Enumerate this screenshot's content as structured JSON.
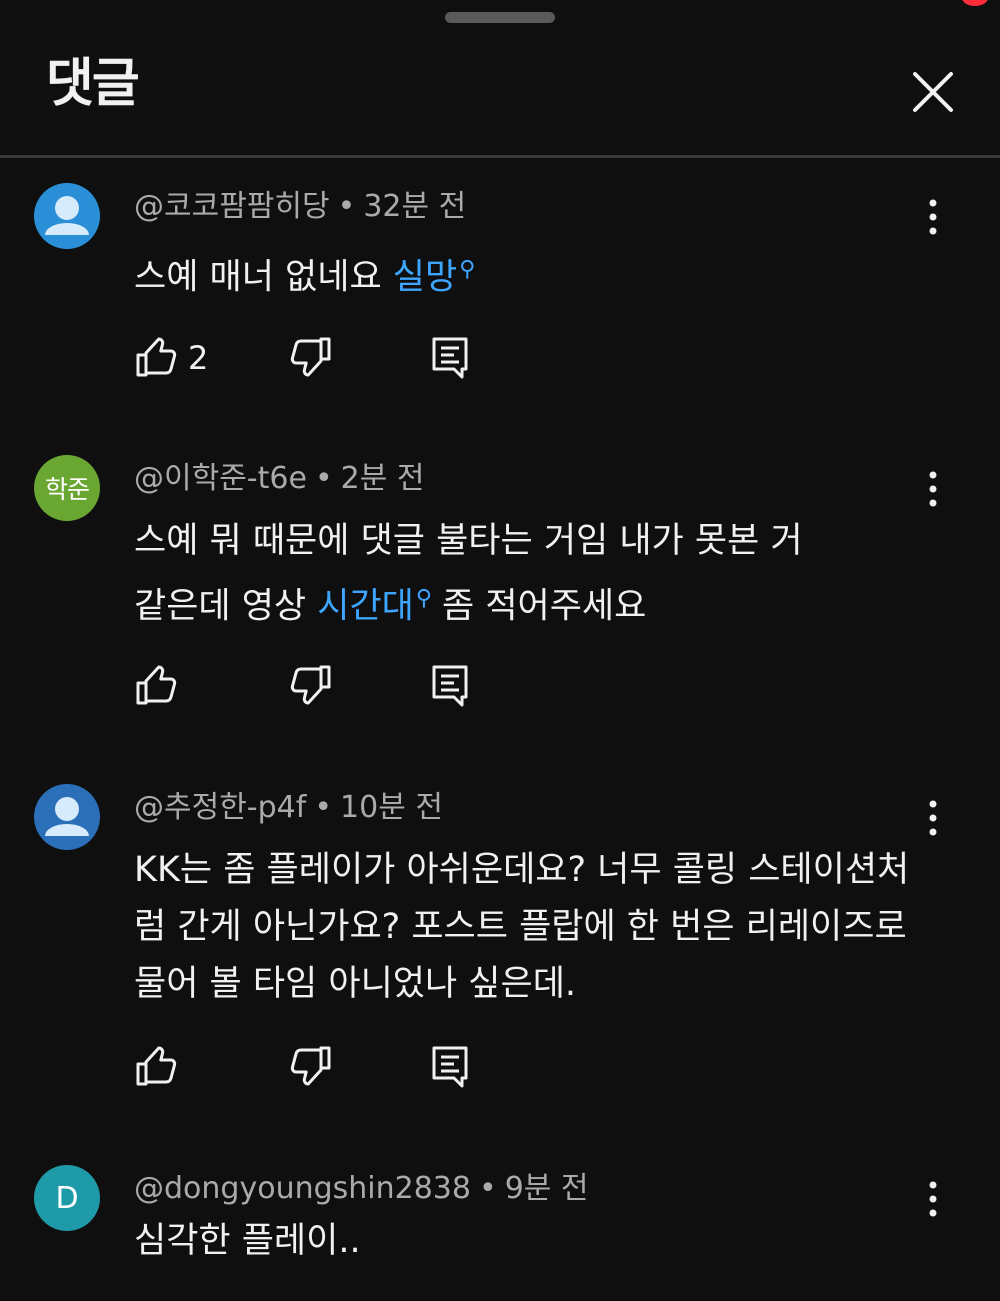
{
  "colors": {
    "background": "#0f0f0f",
    "link": "#3ea6ff",
    "meta": "#aaaaaa",
    "avatar_blue": "#2a8fd6",
    "avatar_green": "#6aa632",
    "avatar_teal": "#1e9aa8"
  },
  "header": {
    "title": "댓글",
    "close_icon": "close-icon"
  },
  "comments": [
    {
      "author": "@코코팜팜히당",
      "time": "32분 전",
      "avatar": {
        "type": "default-person",
        "color": "#2a8fd6"
      },
      "text_parts": {
        "before": "스예 매너 없네요 ",
        "link": "실망",
        "after": ""
      },
      "likes": "2"
    },
    {
      "author": "@이학준-t6e",
      "time": "2분 전",
      "avatar": {
        "type": "initials",
        "label": "학준",
        "color": "#6aa632"
      },
      "text_parts": {
        "before": "스예 뭐 때문에 댓글 불타는 거임 내가 못본 거 같은데 영상 ",
        "link": "시간대",
        "after": "좀 적어주세요"
      },
      "likes": ""
    },
    {
      "author": "@추정한-p4f",
      "time": "10분 전",
      "avatar": {
        "type": "default-person",
        "color": "#2a6fb8"
      },
      "text_parts": {
        "before": "KK는 좀 플레이가 아쉬운데요? 너무 콜링 스테이션처럼 간게 아닌가요? 포스트 플랍에 한 번은 리레이즈로 물어 볼 타임 아니었나 싶은데.",
        "link": "",
        "after": ""
      },
      "likes": ""
    },
    {
      "author": "@dongyoungshin2838",
      "time": "9분 전",
      "avatar": {
        "type": "letter",
        "label": "D",
        "color": "#1e9aa8"
      },
      "text_parts": {
        "before": "심각한 플레이..",
        "link": "",
        "after": ""
      },
      "likes": ""
    }
  ]
}
